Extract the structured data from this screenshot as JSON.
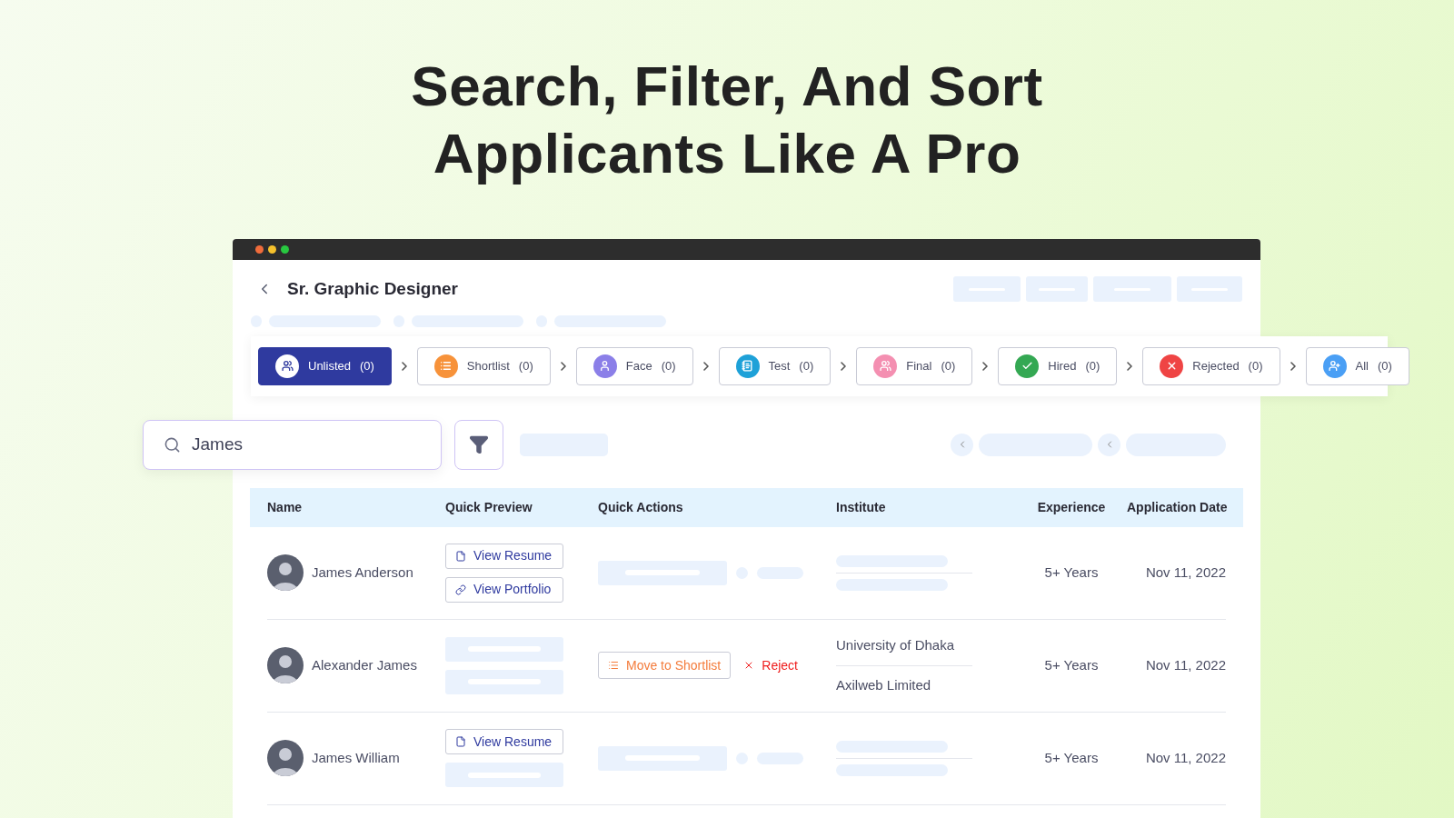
{
  "headline": [
    "Search, Filter, And Sort",
    "Applicants Like A Pro"
  ],
  "job": {
    "title": "Sr. Graphic Designer"
  },
  "stages": [
    {
      "label": "Unlisted",
      "count": "(0)",
      "selected": true,
      "color": "#2f3a9f"
    },
    {
      "label": "Shortlist",
      "count": "(0)",
      "selected": false,
      "color": "#f7923a"
    },
    {
      "label": "Face",
      "count": "(0)",
      "selected": false,
      "color": "#8b7fe8"
    },
    {
      "label": "Test",
      "count": "(0)",
      "selected": false,
      "color": "#1ea1d8"
    },
    {
      "label": "Final",
      "count": "(0)",
      "selected": false,
      "color": "#f48fb1"
    },
    {
      "label": "Hired",
      "count": "(0)",
      "selected": false,
      "color": "#34a853"
    },
    {
      "label": "Rejected",
      "count": "(0)",
      "selected": false,
      "color": "#ef4444"
    },
    {
      "label": "All",
      "count": "(0)",
      "selected": false,
      "color": "#4a9ff5"
    }
  ],
  "search": {
    "value": "James"
  },
  "table": {
    "columns": [
      "Name",
      "Quick Preview",
      "Quick Actions",
      "Institute",
      "Experience",
      "Application Date"
    ],
    "rows": [
      {
        "name": "James Anderson",
        "preview": [
          {
            "kind": "resume",
            "label": "View Resume"
          },
          {
            "kind": "portfolio",
            "label": "View Portfolio"
          }
        ],
        "actions": [],
        "institute": [],
        "experience": "5+ Years",
        "date": "Nov 11, 2022"
      },
      {
        "name": "Alexander James",
        "preview": [],
        "actions": [
          {
            "kind": "shortlist",
            "label": "Move to Shortlist"
          },
          {
            "kind": "reject",
            "label": "Reject"
          }
        ],
        "institute": [
          "University of Dhaka",
          "Axilweb Limited"
        ],
        "experience": "5+ Years",
        "date": "Nov 11, 2022"
      },
      {
        "name": "James William",
        "preview": [
          {
            "kind": "resume",
            "label": "View Resume"
          }
        ],
        "actions": [],
        "institute": [],
        "experience": "5+ Years",
        "date": "Nov 11, 2022"
      }
    ]
  }
}
